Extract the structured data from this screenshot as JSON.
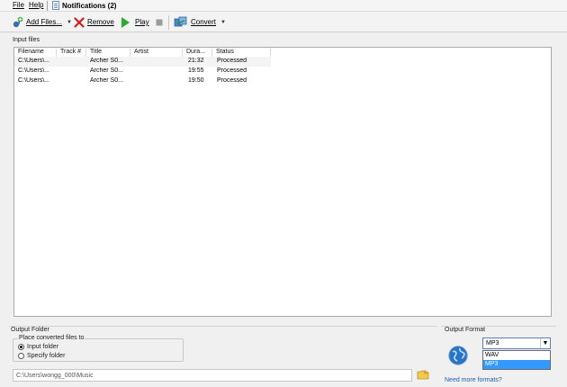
{
  "menu": {
    "file": "File",
    "help": "Help",
    "notifications": "Notifications (2)"
  },
  "toolbar": {
    "add_files": "Add Files...",
    "remove": "Remove",
    "play": "Play",
    "convert": "Convert"
  },
  "input_files": {
    "title": "Input files",
    "columns": [
      "Filename",
      "Track #",
      "Title",
      "Artist",
      "Dura...",
      "Status"
    ],
    "rows": [
      {
        "filename": "C:\\Users\\...",
        "track": "",
        "title": "Archer S0...",
        "artist": "",
        "duration": "21:32",
        "status": "Processed"
      },
      {
        "filename": "C:\\Users\\...",
        "track": "",
        "title": "Archer S0...",
        "artist": "",
        "duration": "19:55",
        "status": "Processed"
      },
      {
        "filename": "C:\\Users\\...",
        "track": "",
        "title": "Archer S0...",
        "artist": "",
        "duration": "19:50",
        "status": "Processed"
      }
    ]
  },
  "output_folder": {
    "title": "Output Folder",
    "place_label": "Place converted files to",
    "option_input": "Input folder",
    "option_specify": "Specify folder",
    "path": "C:\\Users\\wongg_000\\Music"
  },
  "output_format": {
    "title": "Output Format",
    "selected": "MP3",
    "options": [
      "WAV",
      "MP3"
    ],
    "more_link": "Need more formats?"
  },
  "colors": {
    "accent": "#3399ff",
    "link": "#1a5fb4",
    "remove_red": "#cc1f1f",
    "play_green": "#2eaa2e"
  }
}
